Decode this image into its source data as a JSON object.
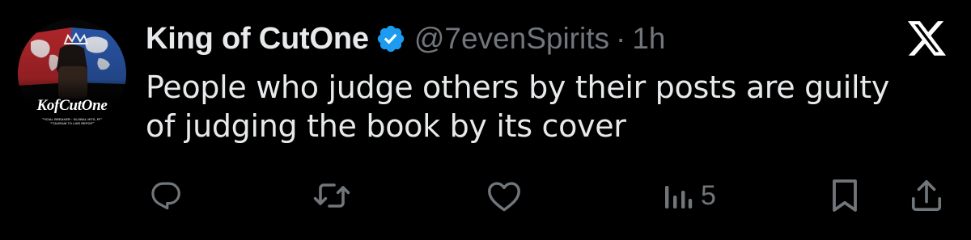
{
  "user": {
    "display_name": "King of CutOne",
    "handle": "@7evenSpirits",
    "separator": "·",
    "time": "1h",
    "verified": true,
    "badge_color": "#1d9bf0",
    "avatar": {
      "brand_text": "KofCutOne",
      "tagline_1": "OFFICIAL BREAKER · GLOBAL HITS, FEED",
      "tagline_2": "INSTAGRAM TO LIKE REPORTS"
    }
  },
  "tweet": {
    "text_line_1": "People who judge others by their posts are guilty",
    "text_line_2": "of judging the book by its cover"
  },
  "actions": {
    "reply_icon": "reply-icon",
    "retweet_icon": "retweet-icon",
    "like_icon": "heart-icon",
    "views_icon": "views-icon",
    "views_count": "5",
    "bookmark_icon": "bookmark-icon",
    "share_icon": "share-icon"
  },
  "brand": {
    "logo": "x-logo-icon"
  },
  "colors": {
    "background": "#000000",
    "primary_text": "#e7e9ea",
    "secondary_text": "#71767b"
  }
}
